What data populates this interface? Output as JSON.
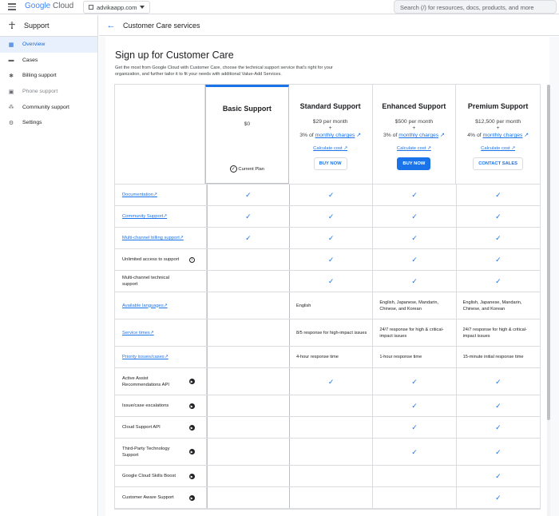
{
  "topbar": {
    "logo_google": "Google",
    "logo_cloud": "Cloud",
    "project": "advikaapp.com",
    "search_placeholder": "Search (/) for resources, docs, products, and more"
  },
  "sidebar": {
    "title": "Support",
    "items": [
      {
        "label": "Overview",
        "icon": "grid-icon",
        "glyph": "▦",
        "state": "active"
      },
      {
        "label": "Cases",
        "icon": "cases-icon",
        "glyph": "▬",
        "state": "normal"
      },
      {
        "label": "Billing support",
        "icon": "gear-icon",
        "glyph": "✱",
        "state": "normal"
      },
      {
        "label": "Phone support",
        "icon": "phone-icon",
        "glyph": "▣",
        "state": "disabled"
      },
      {
        "label": "Community support",
        "icon": "people-icon",
        "glyph": "⁂",
        "state": "normal"
      },
      {
        "label": "Settings",
        "icon": "settings-icon",
        "glyph": "⚙",
        "state": "normal"
      }
    ]
  },
  "header": {
    "title": "Customer Care services"
  },
  "page": {
    "title": "Sign up for Customer Care",
    "description": "Get the most from Google Cloud with Customer Care, choose the technical support service that's right for your organization, and further tailor it to fit your needs with additional Value-Add Services."
  },
  "plans": [
    {
      "name": "Basic Support",
      "price": "$0",
      "plus": "",
      "pct": "",
      "link": "",
      "calc": "",
      "button": "",
      "current_label": "Current Plan"
    },
    {
      "name": "Standard Support",
      "price": "$29 per month",
      "plus": "+",
      "pct": "3% of",
      "link": "monthly charges",
      "calc": "Calculate cost",
      "button": "BUY NOW",
      "button_style": "outline"
    },
    {
      "name": "Enhanced Support",
      "price": "$500 per month",
      "plus": "+",
      "pct": "3% of",
      "link": "monthly charges",
      "calc": "Calculate cost",
      "button": "BUY NOW",
      "button_style": "primary"
    },
    {
      "name": "Premium Support",
      "price": "$12,500 per month",
      "plus": "+",
      "pct": "4% of",
      "link": "monthly charges",
      "calc": "Calculate cost",
      "button": "CONTACT SALES",
      "button_style": "outline"
    }
  ],
  "rows": [
    {
      "label": "Documentation",
      "style": "link",
      "cells": [
        "✓",
        "✓",
        "✓",
        "✓"
      ]
    },
    {
      "label": "Community Support",
      "style": "link",
      "cells": [
        "✓",
        "✓",
        "✓",
        "✓"
      ]
    },
    {
      "label": "Multi-channel billing support",
      "style": "link",
      "cells": [
        "✓",
        "✓",
        "✓",
        "✓"
      ]
    },
    {
      "label": "Unlimited access to support",
      "style": "info",
      "cells": [
        "",
        "✓",
        "✓",
        "✓"
      ]
    },
    {
      "label": "Multi-channel technical support",
      "style": "plain",
      "cells": [
        "",
        "✓",
        "✓",
        "✓"
      ]
    },
    {
      "label": "Available languages",
      "style": "link",
      "cells": [
        "",
        "English",
        "English, Japanese, Mandarin, Chinese, and Korean",
        "English, Japanese, Mandarin, Chinese, and Korean"
      ]
    },
    {
      "label": "Service times",
      "style": "link",
      "cells": [
        "",
        "8/5 response for high-impact issues",
        "24/7 response for high & critical-impact issues",
        "24/7 response for high & critical-impact issues"
      ]
    },
    {
      "label": "Priority issues/cases",
      "style": "link",
      "cells": [
        "",
        "4-hour response time",
        "1-hour response time",
        "15-minute initial response time"
      ]
    },
    {
      "label": "Active Assist Recommendations API",
      "style": "play",
      "cells": [
        "",
        "✓",
        "✓",
        "✓"
      ]
    },
    {
      "label": "Issue/case escalations",
      "style": "play",
      "cells": [
        "",
        "",
        "✓",
        "✓"
      ]
    },
    {
      "label": "Cloud Support API",
      "style": "play",
      "cells": [
        "",
        "",
        "✓",
        "✓"
      ]
    },
    {
      "label": "Third-Party Technology Support",
      "style": "play",
      "cells": [
        "",
        "",
        "✓",
        "✓"
      ]
    },
    {
      "label": "Google Cloud Skills Boost",
      "style": "play",
      "cells": [
        "",
        "",
        "",
        "✓"
      ]
    },
    {
      "label": "Customer Aware Support",
      "style": "play",
      "cells": [
        "",
        "",
        "",
        "✓"
      ]
    }
  ]
}
